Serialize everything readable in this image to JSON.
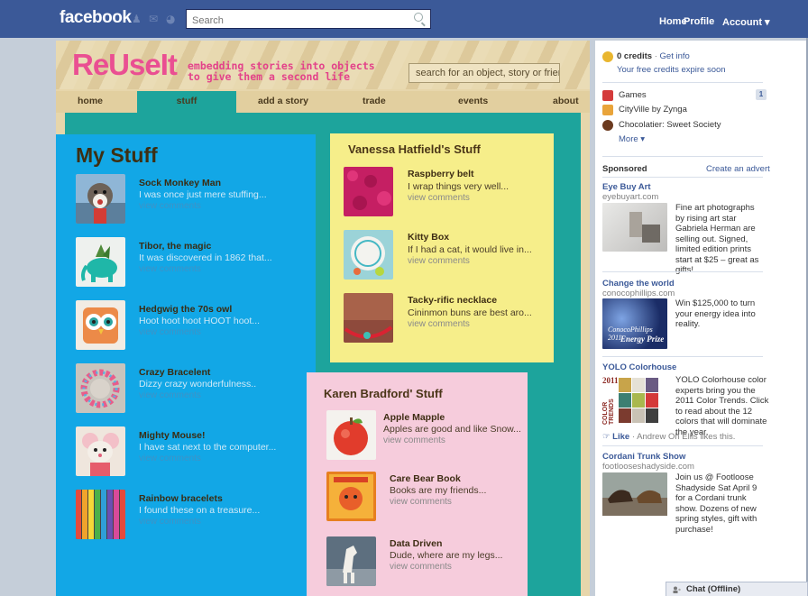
{
  "fb": {
    "logo": "facebook",
    "search_placeholder": "Search",
    "nav": [
      "Home",
      "Profile",
      "Account ▾"
    ]
  },
  "app": {
    "logo": "ReUseIt",
    "tagline_1": "embedding stories into objects",
    "tagline_2": "to give them a second life",
    "search_placeholder": "search for an object, story or friend",
    "tabs": [
      "home",
      "stuff",
      "add a story",
      "trade",
      "events",
      "about"
    ],
    "active_tab": "stuff"
  },
  "my_stuff": {
    "title": "My Stuff",
    "items": [
      {
        "title": "Sock Monkey Man",
        "desc": "I was once just mere stuffing...",
        "link": "view comments"
      },
      {
        "title": "Tibor, the magic",
        "desc": "It was discovered in 1862 that...",
        "link": "view comments"
      },
      {
        "title": "Hedgwig the 70s owl",
        "desc": "Hoot hoot hoot HOOT hoot...",
        "link": "view comments"
      },
      {
        "title": "Crazy Bracelent",
        "desc": "Dizzy crazy wonderfulness..",
        "link": "view comments"
      },
      {
        "title": "Mighty Mouse!",
        "desc": "I have sat next to the computer...",
        "link": "view comments"
      },
      {
        "title": "Rainbow bracelets",
        "desc": "I found these on a treasure...",
        "link": "view comments"
      }
    ]
  },
  "vanessa": {
    "title": "Vanessa Hatfield's Stuff",
    "items": [
      {
        "title": "Raspberry belt",
        "desc": "I wrap things very well...",
        "link": "view comments"
      },
      {
        "title": "Kitty Box",
        "desc": "If I had a cat, it would live in...",
        "link": "view comments"
      },
      {
        "title": "Tacky-rific necklace",
        "desc": "Cininmon buns are best aro...",
        "link": "view comments"
      }
    ]
  },
  "karen": {
    "title": "Karen Bradford' Stuff",
    "items": [
      {
        "title": "Apple Mapple",
        "desc": "Apples are good and like Snow...",
        "link": "view comments"
      },
      {
        "title": "Care Bear Book",
        "desc": "Books are my friends...",
        "link": "view comments"
      },
      {
        "title": "Data Driven",
        "desc": "Dude, where are my legs...",
        "link": "view comments"
      }
    ]
  },
  "sidebar": {
    "credits": "0 credits",
    "get_info": "Get info",
    "credits_sep": " · ",
    "expire": "Your free credits expire soon",
    "apps": [
      "Games",
      "CityVille by Zynga",
      "Chocolatier: Sweet Society"
    ],
    "games_badge": "1",
    "more": "More ▾",
    "sponsored": "Sponsored",
    "create_advert": "Create an advert",
    "ads": [
      {
        "title": "Eye Buy Art",
        "url": "eyebuyart.com",
        "body": "Fine art photographs by rising art star Gabriela Herman are selling out. Signed, limited edition prints start at $25 – great as gifts!"
      },
      {
        "title": "Change the world",
        "url": "conocophillips.com",
        "body": "Win $125,000 to turn your energy idea into reality.",
        "img_text_1": "ConocoPhillips 2011",
        "img_text_2": "Energy Prize"
      },
      {
        "title": "YOLO Colorhouse",
        "url": "",
        "body": "YOLO Colorhouse color experts bring you the 2011 Color Trends. Click to read about the 12 colors that will dominate the year.",
        "img_year": "2011",
        "img_word": "COLOR TRENDS"
      },
      {
        "title": "Cordani Trunk Show",
        "url": "footlooseshadyside.com",
        "body": "Join us @ Footloose Shadyside Sat April 9 for a Cordani trunk show. Dozens of new spring styles, gift with purchase!"
      }
    ],
    "like": "Like",
    "like_text": " · Andrew Oh Ellis likes this."
  },
  "chat": "Chat (Offline)"
}
